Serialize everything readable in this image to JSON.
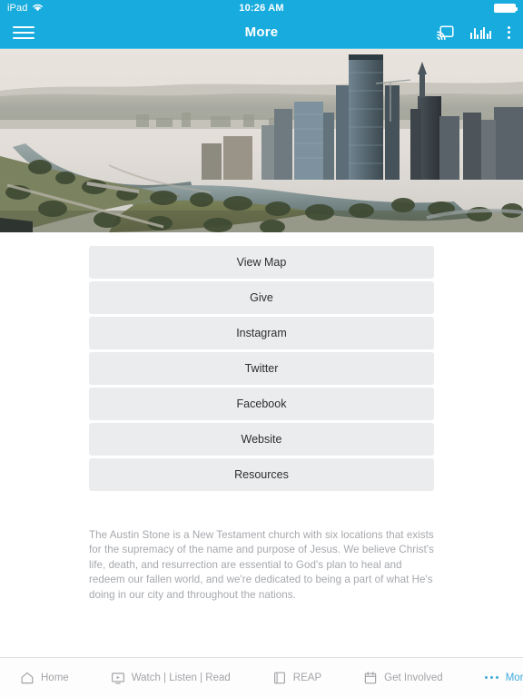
{
  "status_bar": {
    "device": "iPad",
    "wifi_icon": "wifi-icon",
    "time": "10:26 AM",
    "battery_icon": "battery-icon"
  },
  "nav_bar": {
    "menu_icon": "hamburger-menu-icon",
    "title": "More",
    "cast_icon": "chromecast-icon",
    "equalizer_icon": "equalizer-icon",
    "overflow_icon": "overflow-menu-icon",
    "background_color": "#17ABDE"
  },
  "hero": {
    "alt": "Aerial photo of downtown Austin skyline with Lady Bird Lake and parkland"
  },
  "buttons": [
    {
      "label": "View Map"
    },
    {
      "label": "Give"
    },
    {
      "label": "Instagram"
    },
    {
      "label": "Twitter"
    },
    {
      "label": "Facebook"
    },
    {
      "label": "Website"
    },
    {
      "label": "Resources"
    }
  ],
  "about": {
    "text": "The Austin Stone is a New Testament church with six locations that exists for the supremacy of the name and purpose of Jesus. We believe Christ's life, death, and resurrection are essential to God's plan to heal and redeem our fallen world, and we're dedicated to being a part of what He's doing in our city and throughout the nations."
  },
  "tab_bar": {
    "active_color": "#3fa9dd",
    "inactive_color": "#a3a4a8",
    "items": [
      {
        "label": "Home",
        "icon": "home-icon",
        "active": false
      },
      {
        "label": "Watch | Listen | Read",
        "icon": "monitor-play-icon",
        "active": false
      },
      {
        "label": "REAP",
        "icon": "book-icon",
        "active": false
      },
      {
        "label": "Get Involved",
        "icon": "calendar-icon",
        "active": false
      },
      {
        "label": "More",
        "icon": "ellipsis-icon",
        "active": true
      }
    ]
  }
}
